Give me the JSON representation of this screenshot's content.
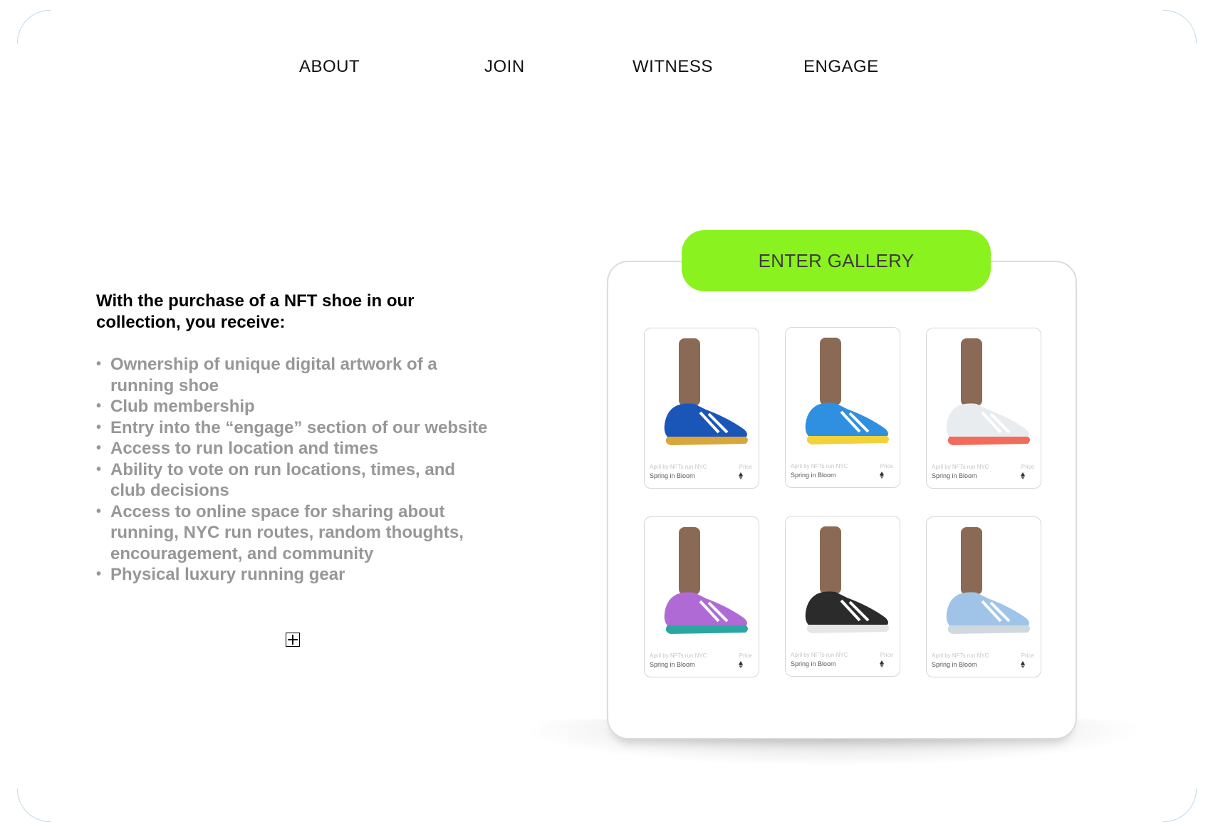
{
  "nav": {
    "items": [
      {
        "label": "ABOUT"
      },
      {
        "label": "JOIN"
      },
      {
        "label": "WITNESS"
      },
      {
        "label": "ENGAGE"
      }
    ]
  },
  "intro": {
    "heading": "With the purchase of a NFT shoe in our collection, you receive:"
  },
  "benefits": [
    "Ownership of unique digital artwork of a running shoe",
    "Club membership",
    "Entry into the “engage” section of our website",
    "Access to run location and times",
    "Ability to vote on run locations, times, and club decisions",
    "Access to online space for sharing about running, NYC run routes, random thoughts, encouragement, and community",
    "Physical luxury running gear"
  ],
  "bullet_char": "•",
  "gallery": {
    "button_label": "ENTER GALLERY",
    "accent_color": "#8af21f",
    "cards": [
      {
        "subtitle": "April by NFTs run NYC",
        "name": "Spring in Bloom",
        "price_label": "Price",
        "shoe_color": "#1a55b8",
        "sole_color": "#d9a63a",
        "icon": "ethereum-icon"
      },
      {
        "subtitle": "April by NFTs run NYC",
        "name": "Spring in Bloom",
        "price_label": "Price",
        "shoe_color": "#2f8fe0",
        "sole_color": "#f2d23c",
        "icon": "ethereum-icon"
      },
      {
        "subtitle": "April by NFTs run NYC",
        "name": "Spring in Bloom",
        "price_label": "Price",
        "shoe_color": "#e9ecef",
        "sole_color": "#f36b5b",
        "icon": "ethereum-icon"
      },
      {
        "subtitle": "April by NFTs run NYC",
        "name": "Spring in Bloom",
        "price_label": "Price",
        "shoe_color": "#b06ad6",
        "sole_color": "#2aa7a0",
        "icon": "ethereum-icon"
      },
      {
        "subtitle": "April by NFTs run NYC",
        "name": "Spring in Bloom",
        "price_label": "Price",
        "shoe_color": "#2b2b2b",
        "sole_color": "#e6e6e6",
        "icon": "ethereum-icon"
      },
      {
        "subtitle": "April by NFTs run NYC",
        "name": "Spring in Bloom",
        "price_label": "Price",
        "shoe_color": "#9fc4e8",
        "sole_color": "#cfd8de",
        "icon": "ethereum-icon"
      }
    ]
  }
}
